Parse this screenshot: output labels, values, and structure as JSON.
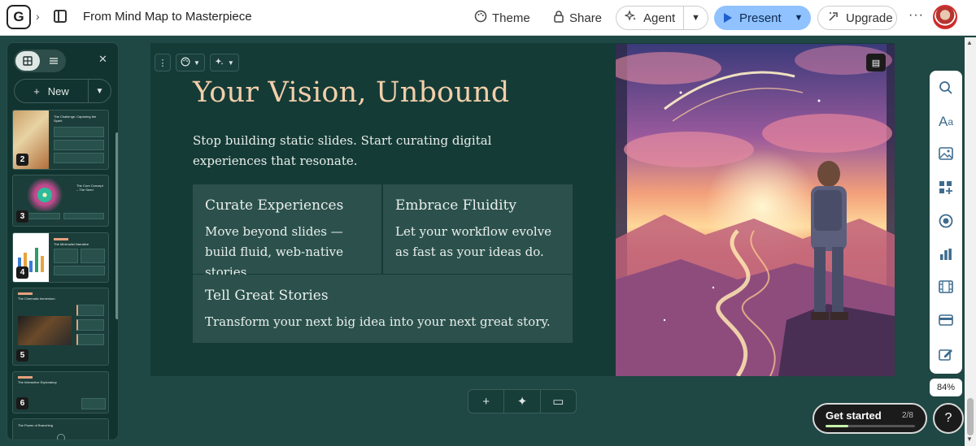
{
  "header": {
    "logo_letter": "G",
    "doc_title": "From Mind Map to Masterpiece",
    "theme_label": "Theme",
    "share_label": "Share",
    "agent_label": "Agent",
    "present_label": "Present",
    "upgrade_label": "Upgrade",
    "more_label": "···"
  },
  "sidebar": {
    "new_label": "New",
    "thumbnails": [
      {
        "num": "2",
        "title": "The Challenge: Capturing the Spark"
      },
      {
        "num": "3",
        "title": "The Core Concept – The Seed"
      },
      {
        "num": "4",
        "title": "The Minimalist Narrative"
      },
      {
        "num": "5",
        "title": "The Cinematic Immersion"
      },
      {
        "num": "6",
        "title": "The Interactive Exploratory"
      },
      {
        "num": "",
        "title": "The Power of Branching"
      }
    ]
  },
  "slide": {
    "title": "Your Vision, Unbound",
    "subtitle": "Stop building static slides. Start curating digital experiences that resonate.",
    "cards": [
      {
        "heading": "Curate Experiences",
        "body": "Move beyond slides — build fluid, web-native stories."
      },
      {
        "heading": "Embrace Fluidity",
        "body": "Let your workflow evolve as fast as your ideas do."
      },
      {
        "heading": "Tell Great Stories",
        "body": "Transform your next big idea into your next great story."
      }
    ]
  },
  "bottom_toolbar": {
    "add": "+",
    "ai": "✦",
    "layout": "▭"
  },
  "zoom": "84%",
  "onboarding": {
    "label": "Get started",
    "count": "2/8",
    "progress": 0.25
  },
  "help_label": "?",
  "colors": {
    "slide_bg": "#153b37",
    "title": "#f2cfa9",
    "card_bg": "#2c514d",
    "present": "#8fc2ff",
    "accent_rail": "#3d6c8f"
  },
  "icons": [
    "palette-icon",
    "lock-icon",
    "sparkle-icon",
    "play-icon",
    "upgrade-icon",
    "search-icon",
    "text-style-icon",
    "image-icon",
    "blocks-icon",
    "ai-icon",
    "chart-icon",
    "video-icon",
    "card-icon",
    "edit-icon",
    "notes-icon"
  ]
}
